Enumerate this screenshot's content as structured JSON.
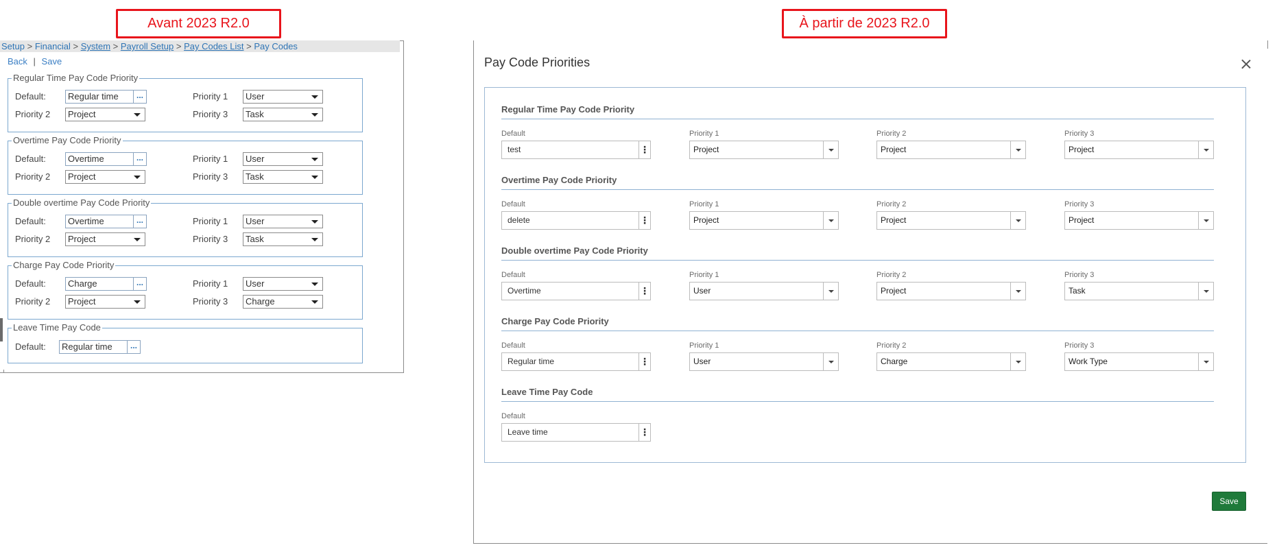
{
  "labels": {
    "before": "Avant 2023 R2.0",
    "after": "À partir de 2023 R2.0"
  },
  "old_ui": {
    "breadcrumb": {
      "setup": "Setup",
      "financial": "Financial",
      "system": "System",
      "payroll_setup": "Payroll Setup",
      "pay_codes_list": "Pay Codes List",
      "pay_codes": "Pay Codes",
      "separator": ">"
    },
    "actions": {
      "back": "Back",
      "divider": "|",
      "save": "Save"
    },
    "ellipsis": "...",
    "default_label": "Default:",
    "p1_label": "Priority 1",
    "p2_label": "Priority 2",
    "p3_label": "Priority 3",
    "sections": [
      {
        "title": "Regular Time Pay Code Priority",
        "default": "Regular time",
        "p1": "User",
        "p2": "Project",
        "p3": "Task"
      },
      {
        "title": "Overtime Pay Code Priority",
        "default": "Overtime",
        "p1": "User",
        "p2": "Project",
        "p3": "Task"
      },
      {
        "title": "Double overtime Pay Code Priority",
        "default": "Overtime",
        "p1": "User",
        "p2": "Project",
        "p3": "Task"
      },
      {
        "title": "Charge Pay Code Priority",
        "default": "Charge",
        "p1": "User",
        "p2": "Project",
        "p3": "Charge"
      },
      {
        "title": "Leave Time Pay Code",
        "default": "Regular time"
      }
    ]
  },
  "new_ui": {
    "title": "Pay Code Priorities",
    "save": "Save",
    "default_label": "Default",
    "p1_label": "Priority 1",
    "p2_label": "Priority 2",
    "p3_label": "Priority 3",
    "kebab": "⋮",
    "sections": [
      {
        "title": "Regular Time Pay Code Priority",
        "default": "test",
        "p1": "Project",
        "p2": "Project",
        "p3": "Project"
      },
      {
        "title": "Overtime Pay Code Priority",
        "default": "delete",
        "p1": "Project",
        "p2": "Project",
        "p3": "Project"
      },
      {
        "title": "Double overtime Pay Code Priority",
        "default": "Overtime",
        "p1": "User",
        "p2": "Project",
        "p3": "Task"
      },
      {
        "title": "Charge Pay Code Priority",
        "default": "Regular time",
        "p1": "User",
        "p2": "Charge",
        "p3": "Work Type"
      },
      {
        "title": "Leave Time Pay Code",
        "default": "Leave time"
      }
    ]
  }
}
